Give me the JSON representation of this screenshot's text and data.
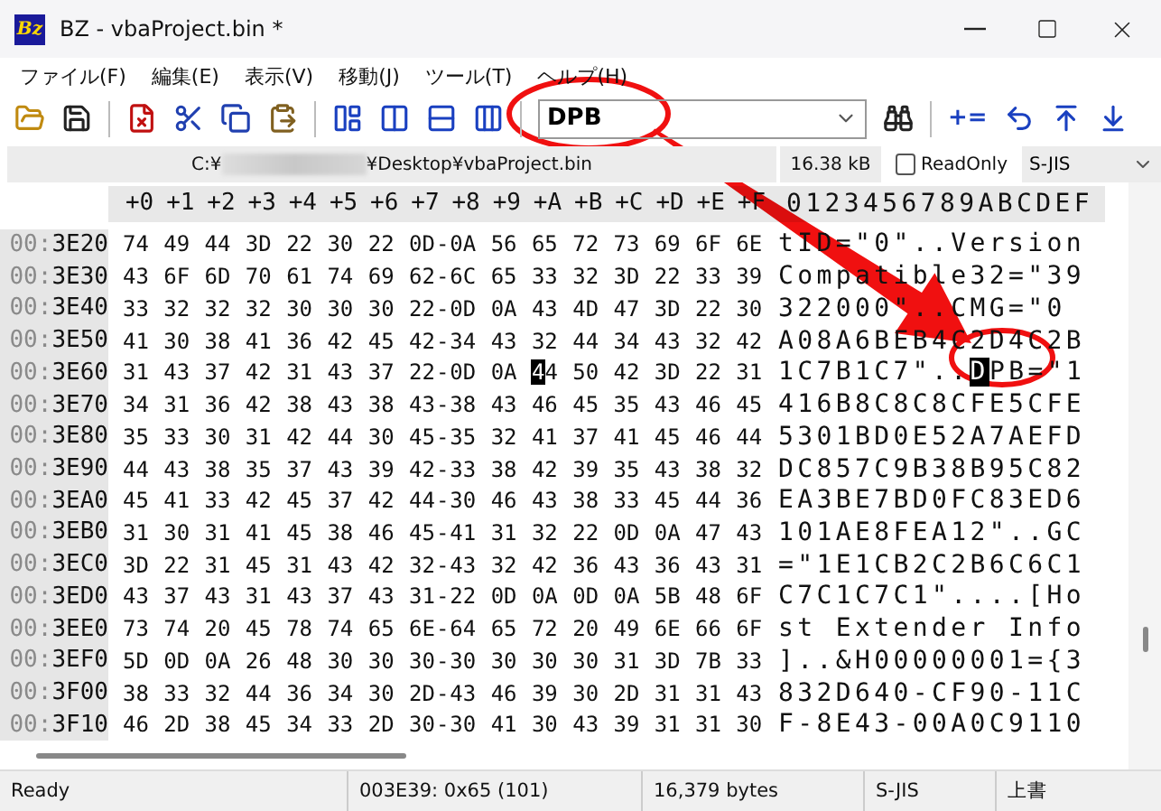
{
  "window": {
    "icon_text": "Bz",
    "title": "BZ - vbaProject.bin *"
  },
  "menu": [
    "ファイル(F)",
    "編集(E)",
    "表示(V)",
    "移動(J)",
    "ツール(T)",
    "ヘルプ(H)"
  ],
  "toolbar": [
    {
      "kind": "icon"
    },
    {
      "kind": "icon"
    },
    {
      "kind": "separator"
    },
    {
      "kind": "icon"
    },
    {
      "kind": "icon"
    },
    {
      "kind": "icon"
    },
    {
      "kind": "icon"
    },
    {
      "kind": "separator"
    },
    {
      "kind": "icon"
    },
    {
      "kind": "icon"
    },
    {
      "kind": "icon"
    },
    {
      "kind": "icon"
    },
    {
      "kind": "separator"
    },
    {
      "kind": "combo",
      "value": "DPB"
    },
    {
      "kind": "icon"
    },
    {
      "kind": "separator"
    },
    {
      "kind": "text",
      "label": "+="
    },
    {
      "kind": "icon"
    },
    {
      "kind": "icon"
    },
    {
      "kind": "icon"
    }
  ],
  "path_bar": {
    "path_start": "C:¥",
    "path_end": "¥Desktop¥vbaProject.bin",
    "size": "16.38 kB",
    "readonly": {
      "label": "ReadOnly",
      "checked": false
    },
    "encoding": "S-JIS"
  },
  "hex_view": {
    "columns": [
      "+0",
      "+1",
      "+2",
      "+3",
      "+4",
      "+5",
      "+6",
      "+7",
      "+8",
      "+9",
      "+A",
      "+B",
      "+C",
      "+D",
      "+E",
      "+F"
    ],
    "ascii_header": "0123456789ABCDEF",
    "separator": "-",
    "rows": [
      {
        "prefix": "00:",
        "address": "3E20",
        "bytes": [
          "74",
          "49",
          "44",
          "3D",
          "22",
          "30",
          "22",
          "0D",
          "0A",
          "56",
          "65",
          "72",
          "73",
          "69",
          "6F",
          "6E"
        ],
        "ascii": "tID=\"0\"..Version"
      },
      {
        "prefix": "00:",
        "address": "3E30",
        "bytes": [
          "43",
          "6F",
          "6D",
          "70",
          "61",
          "74",
          "69",
          "62",
          "6C",
          "65",
          "33",
          "32",
          "3D",
          "22",
          "33",
          "39"
        ],
        "ascii": "Compatible32=\"39"
      },
      {
        "prefix": "00:",
        "address": "3E40",
        "bytes": [
          "33",
          "32",
          "32",
          "32",
          "30",
          "30",
          "30",
          "22",
          "0D",
          "0A",
          "43",
          "4D",
          "47",
          "3D",
          "22",
          "30"
        ],
        "ascii": "322000\"..CMG=\"0"
      },
      {
        "prefix": "00:",
        "address": "3E50",
        "bytes": [
          "41",
          "30",
          "38",
          "41",
          "36",
          "42",
          "45",
          "42",
          "34",
          "43",
          "32",
          "44",
          "34",
          "43",
          "32",
          "42"
        ],
        "ascii": "A08A6BEB4C2D4C2B"
      },
      {
        "prefix": "00:",
        "address": "3E60",
        "bytes": [
          "31",
          "43",
          "37",
          "42",
          "31",
          "43",
          "37",
          "22",
          "0D",
          "0A",
          "44",
          "50",
          "42",
          "3D",
          "22",
          "31"
        ],
        "ascii": "1C7B1C7\"..DPB=\"1",
        "cursor": [
          false,
          false,
          false,
          false,
          false,
          false,
          false,
          false,
          false,
          false,
          true,
          false,
          false,
          false,
          false,
          false
        ]
      },
      {
        "prefix": "00:",
        "address": "3E70",
        "bytes": [
          "34",
          "31",
          "36",
          "42",
          "38",
          "43",
          "38",
          "43",
          "38",
          "43",
          "46",
          "45",
          "35",
          "43",
          "46",
          "45"
        ],
        "ascii": "416B8C8C8CFE5CFE"
      },
      {
        "prefix": "00:",
        "address": "3E80",
        "bytes": [
          "35",
          "33",
          "30",
          "31",
          "42",
          "44",
          "30",
          "45",
          "35",
          "32",
          "41",
          "37",
          "41",
          "45",
          "46",
          "44"
        ],
        "ascii": "5301BD0E52A7AEFD"
      },
      {
        "prefix": "00:",
        "address": "3E90",
        "bytes": [
          "44",
          "43",
          "38",
          "35",
          "37",
          "43",
          "39",
          "42",
          "33",
          "38",
          "42",
          "39",
          "35",
          "43",
          "38",
          "32"
        ],
        "ascii": "DC857C9B38B95C82"
      },
      {
        "prefix": "00:",
        "address": "3EA0",
        "bytes": [
          "45",
          "41",
          "33",
          "42",
          "45",
          "37",
          "42",
          "44",
          "30",
          "46",
          "43",
          "38",
          "33",
          "45",
          "44",
          "36"
        ],
        "ascii": "EA3BE7BD0FC83ED6"
      },
      {
        "prefix": "00:",
        "address": "3EB0",
        "bytes": [
          "31",
          "30",
          "31",
          "41",
          "45",
          "38",
          "46",
          "45",
          "41",
          "31",
          "32",
          "22",
          "0D",
          "0A",
          "47",
          "43"
        ],
        "ascii": "101AE8FEA12\"..GC"
      },
      {
        "prefix": "00:",
        "address": "3EC0",
        "bytes": [
          "3D",
          "22",
          "31",
          "45",
          "31",
          "43",
          "42",
          "32",
          "43",
          "32",
          "42",
          "36",
          "43",
          "36",
          "43",
          "31"
        ],
        "ascii": "=\"1E1CB2C2B6C6C1"
      },
      {
        "prefix": "00:",
        "address": "3ED0",
        "bytes": [
          "43",
          "37",
          "43",
          "31",
          "43",
          "37",
          "43",
          "31",
          "22",
          "0D",
          "0A",
          "0D",
          "0A",
          "5B",
          "48",
          "6F"
        ],
        "ascii": "C7C1C7C1\"....[Ho"
      },
      {
        "prefix": "00:",
        "address": "3EE0",
        "bytes": [
          "73",
          "74",
          "20",
          "45",
          "78",
          "74",
          "65",
          "6E",
          "64",
          "65",
          "72",
          "20",
          "49",
          "6E",
          "66",
          "6F"
        ],
        "ascii": "st Extender Info"
      },
      {
        "prefix": "00:",
        "address": "3EF0",
        "bytes": [
          "5D",
          "0D",
          "0A",
          "26",
          "48",
          "30",
          "30",
          "30",
          "30",
          "30",
          "30",
          "30",
          "31",
          "3D",
          "7B",
          "33"
        ],
        "ascii": "]..&H00000001={3"
      },
      {
        "prefix": "00:",
        "address": "3F00",
        "bytes": [
          "38",
          "33",
          "32",
          "44",
          "36",
          "34",
          "30",
          "2D",
          "43",
          "46",
          "39",
          "30",
          "2D",
          "31",
          "31",
          "43"
        ],
        "ascii": "832D640-CF90-11C"
      },
      {
        "prefix": "00:",
        "address": "3F10",
        "bytes": [
          "46",
          "2D",
          "38",
          "45",
          "34",
          "33",
          "2D",
          "30",
          "30",
          "41",
          "30",
          "43",
          "39",
          "31",
          "31",
          "30"
        ],
        "ascii": "F-8E43-00A0C9110"
      }
    ]
  },
  "status_bar": [
    "Ready",
    "003E39: 0x65 (101)",
    "16,379 bytes",
    "S-JIS",
    "上書"
  ]
}
